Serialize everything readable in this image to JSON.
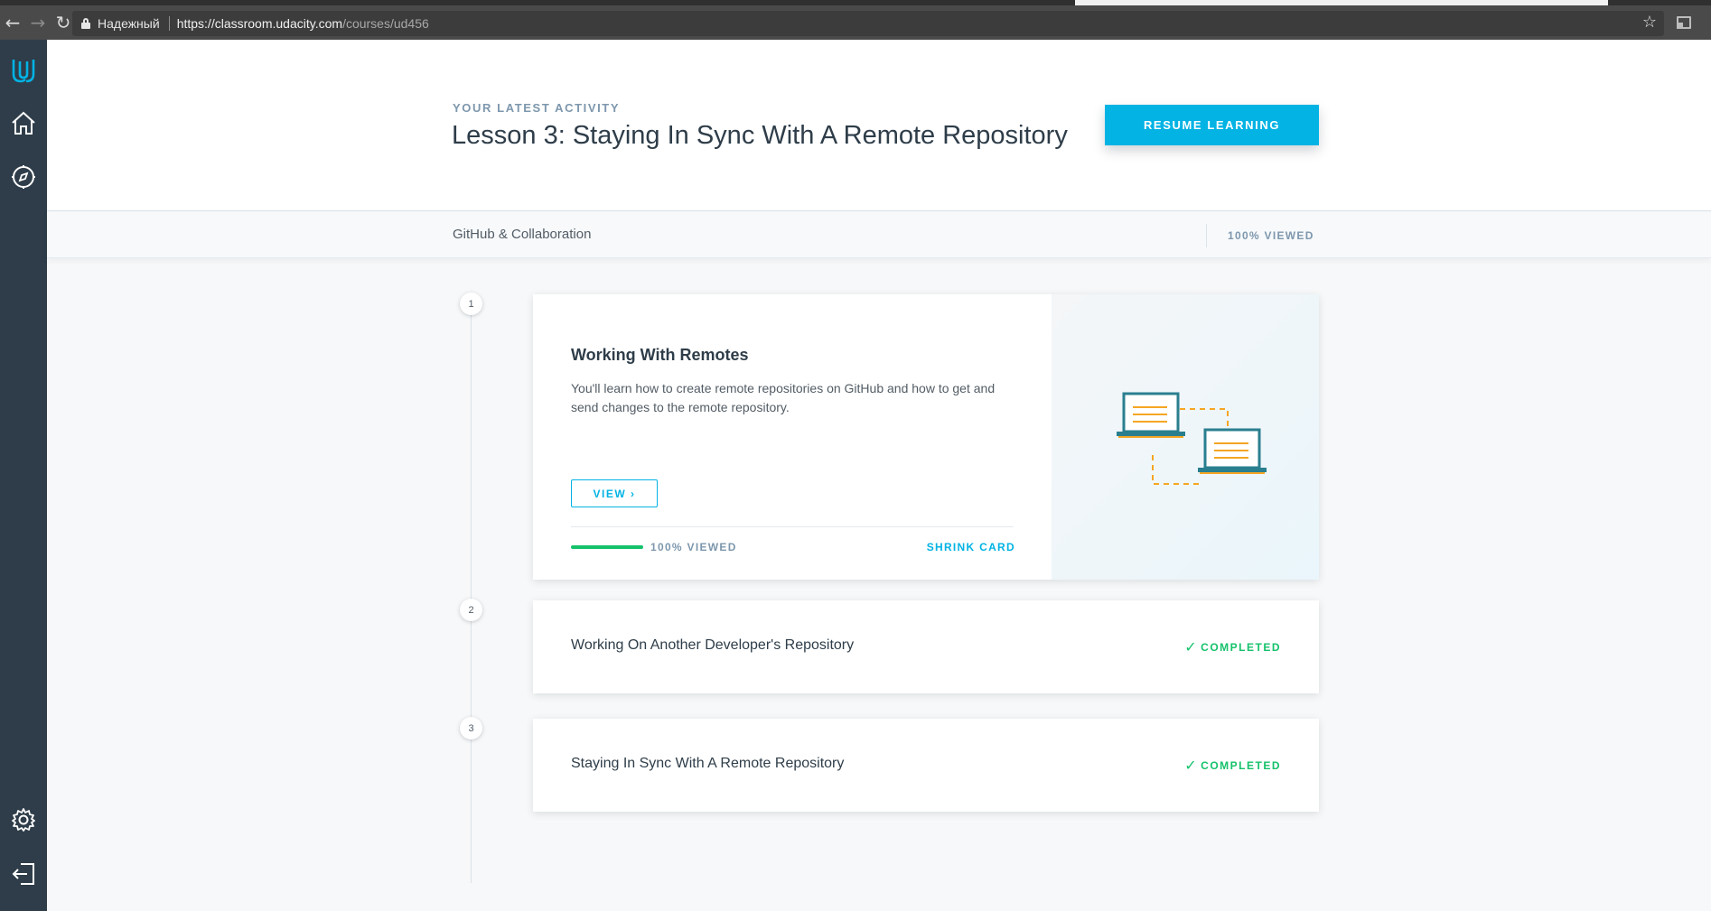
{
  "browser": {
    "secure_label": "Надежный",
    "url_host": "https://classroom.udacity.com",
    "url_path": "/courses/ud456"
  },
  "sidebar": {
    "items": [
      "udacity-logo-icon",
      "home-icon",
      "compass-icon",
      "settings-icon",
      "logout-icon"
    ]
  },
  "hero": {
    "eyebrow": "YOUR LATEST ACTIVITY",
    "title": "Lesson 3: Staying In Sync With A Remote Repository",
    "resume_label": "RESUME LEARNING"
  },
  "subbar": {
    "title": "GitHub & Collaboration",
    "progress": "100% VIEWED"
  },
  "lessons": [
    {
      "number": "1",
      "title": "Working With Remotes",
      "description": "You'll learn how to create remote repositories on GitHub and how to get and send changes to the remote repository.",
      "view_label": "VIEW",
      "progress_percent": 100,
      "progress_label": "100% VIEWED",
      "shrink_label": "SHRINK CARD"
    },
    {
      "number": "2",
      "title": "Working On Another Developer's Repository",
      "status": "COMPLETED"
    },
    {
      "number": "3",
      "title": "Staying In Sync With A Remote Repository",
      "status": "COMPLETED"
    }
  ],
  "colors": {
    "accent": "#02b3e4",
    "success": "#15c26b",
    "sidebar": "#2e3d49"
  }
}
